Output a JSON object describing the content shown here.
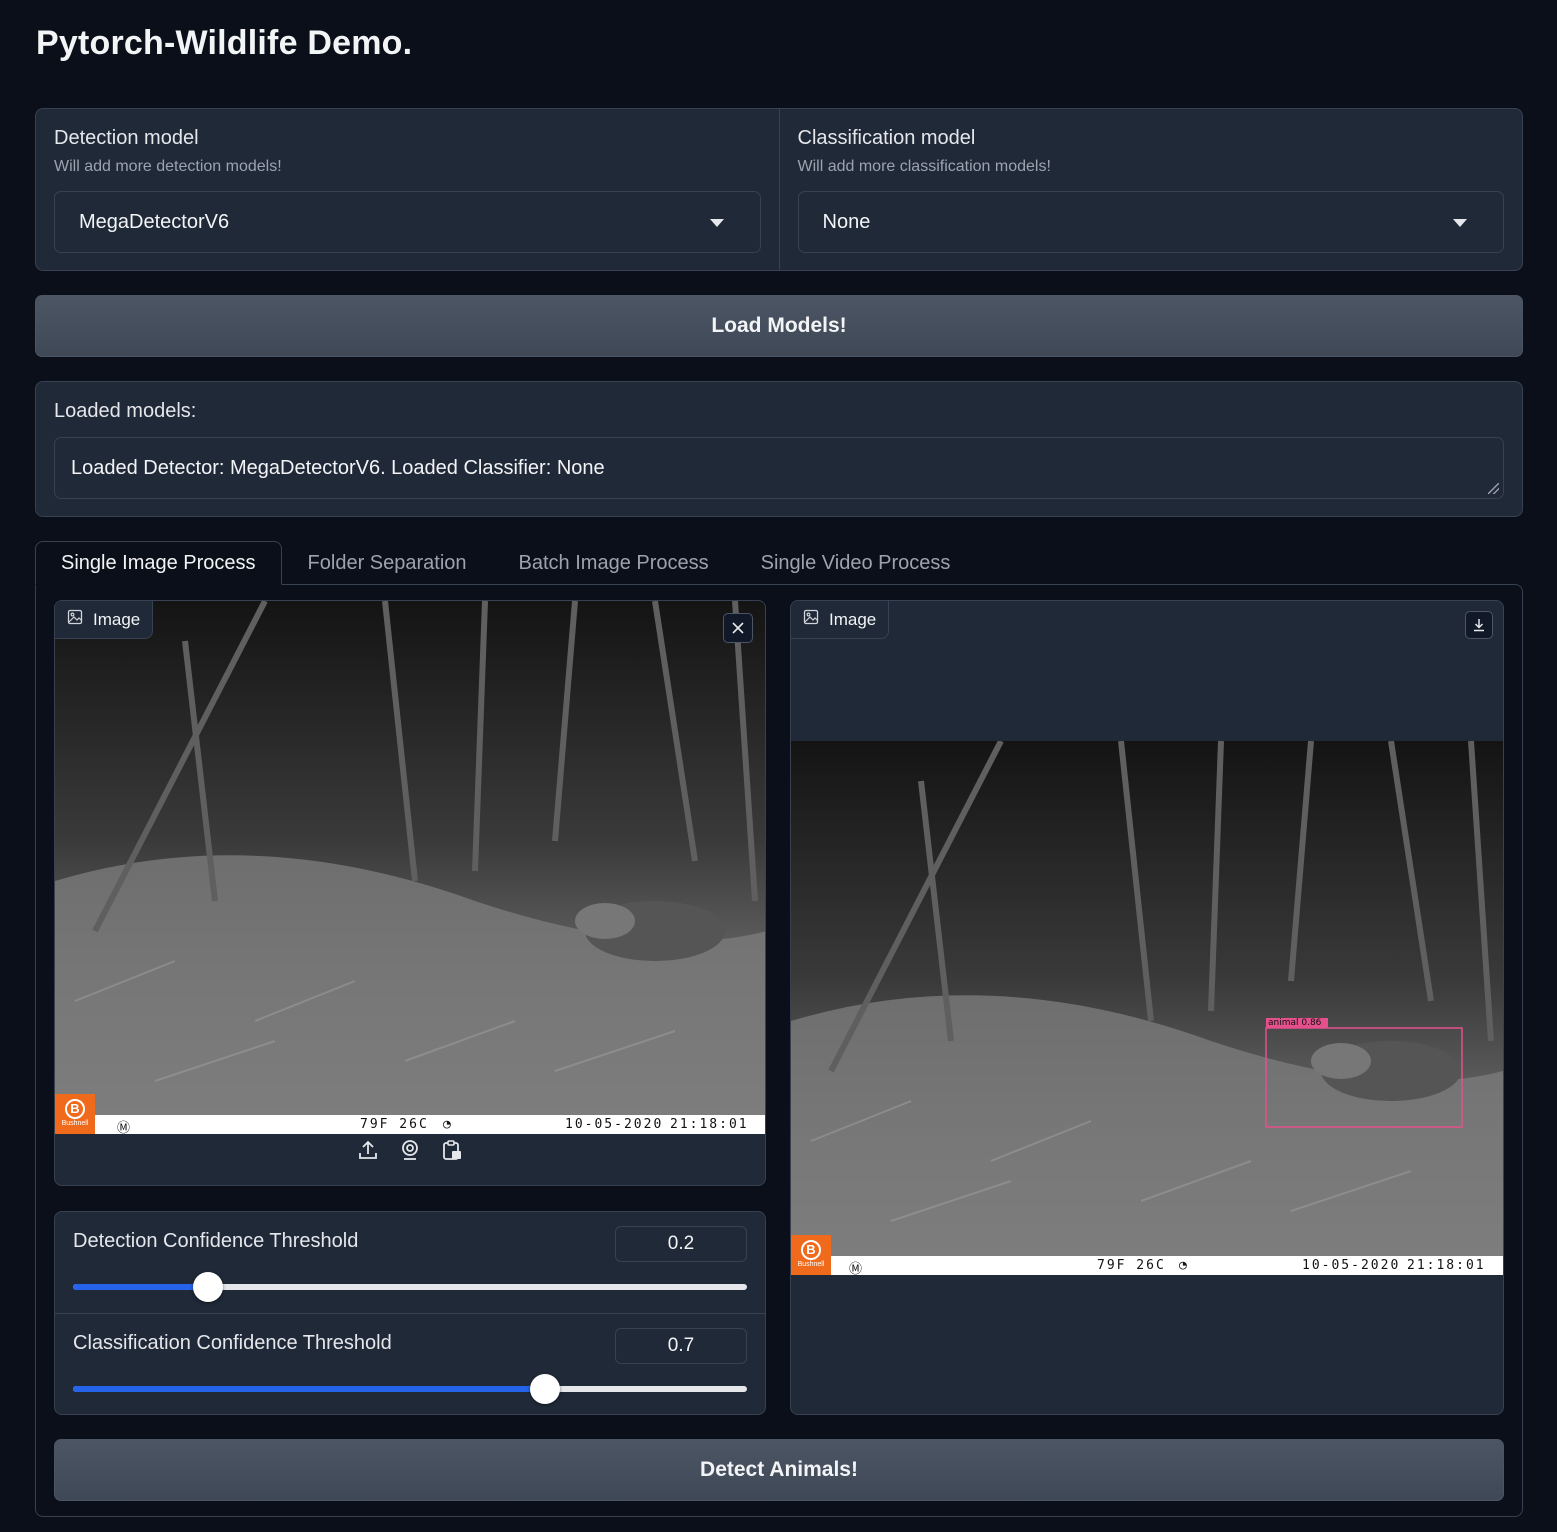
{
  "title": "Pytorch-Wildlife Demo.",
  "detection": {
    "label": "Detection model",
    "info": "Will add more detection models!",
    "value": "MegaDetectorV6"
  },
  "classification": {
    "label": "Classification model",
    "info": "Will add more classification models!",
    "value": "None"
  },
  "load_button": "Load Models!",
  "loaded": {
    "label": "Loaded models:",
    "value": "Loaded Detector: MegaDetectorV6. Loaded Classifier: None"
  },
  "tabs": [
    {
      "label": "Single Image Process",
      "active": true
    },
    {
      "label": "Folder Separation",
      "active": false
    },
    {
      "label": "Batch Image Process",
      "active": false
    },
    {
      "label": "Single Video Process",
      "active": false
    }
  ],
  "input_image": {
    "label": "Image",
    "stamp": {
      "temp": "79F  26C",
      "date": "10-05-2020",
      "time": "21:18:01",
      "brand": "Bushnell"
    }
  },
  "output_image": {
    "label": "Image",
    "detection_label": "animal  0.86",
    "stamp": {
      "temp": "79F  26C",
      "date": "10-05-2020",
      "time": "21:18:01",
      "brand": "Bushnell"
    }
  },
  "sliders": {
    "detection": {
      "label": "Detection Confidence Threshold",
      "value": "0.2",
      "fraction": 0.2
    },
    "classification": {
      "label": "Classification Confidence Threshold",
      "value": "0.7",
      "fraction": 0.7
    }
  },
  "detect_button": "Detect Animals!",
  "colors": {
    "background": "#0b0f19",
    "panel": "#1f2937",
    "accent": "#2563eb",
    "bbox": "#e4508b"
  },
  "icons": [
    "image-icon",
    "close-icon",
    "download-icon",
    "upload-icon",
    "webcam-icon",
    "clipboard-icon",
    "chevron-down-icon"
  ]
}
